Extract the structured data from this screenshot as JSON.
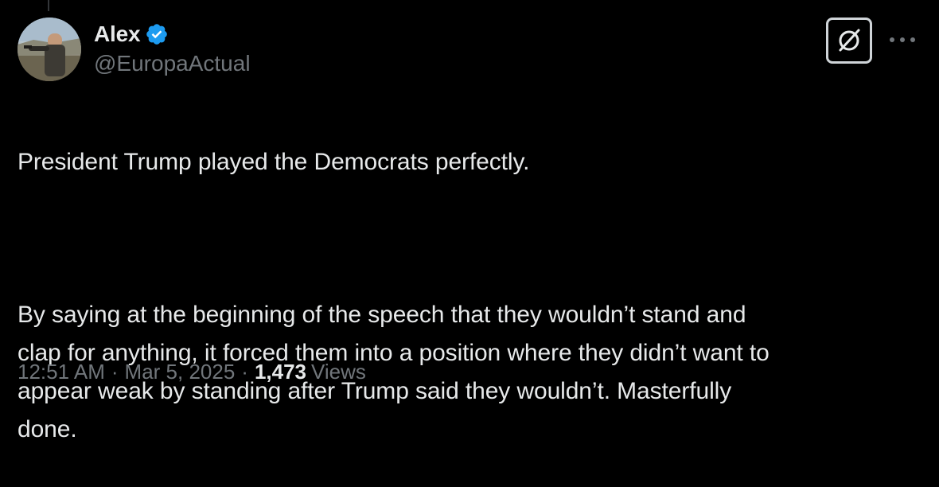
{
  "author": {
    "display_name": "Alex",
    "handle": "@EuropaActual",
    "verified": true,
    "verified_color": "#1d9bf0"
  },
  "tweet": {
    "paragraphs": [
      "President Trump played the Democrats perfectly.",
      "By saying at the beginning of the speech that they wouldn’t stand and\nclap for anything, it forced them into a position where they didn’t want to\nappear weak by standing after Trump said they wouldn’t. Masterfully\ndone."
    ]
  },
  "meta": {
    "time": "12:51 AM",
    "date": "Mar 5, 2025",
    "separator": "·",
    "views_count": "1,473",
    "views_label": "Views"
  },
  "icons": {
    "grok": "grok-icon",
    "more": "more-horizontal-icon",
    "verified": "verified-badge-icon"
  },
  "colors": {
    "background": "#000000",
    "text_primary": "#e7e9ea",
    "text_secondary": "#71767b"
  }
}
